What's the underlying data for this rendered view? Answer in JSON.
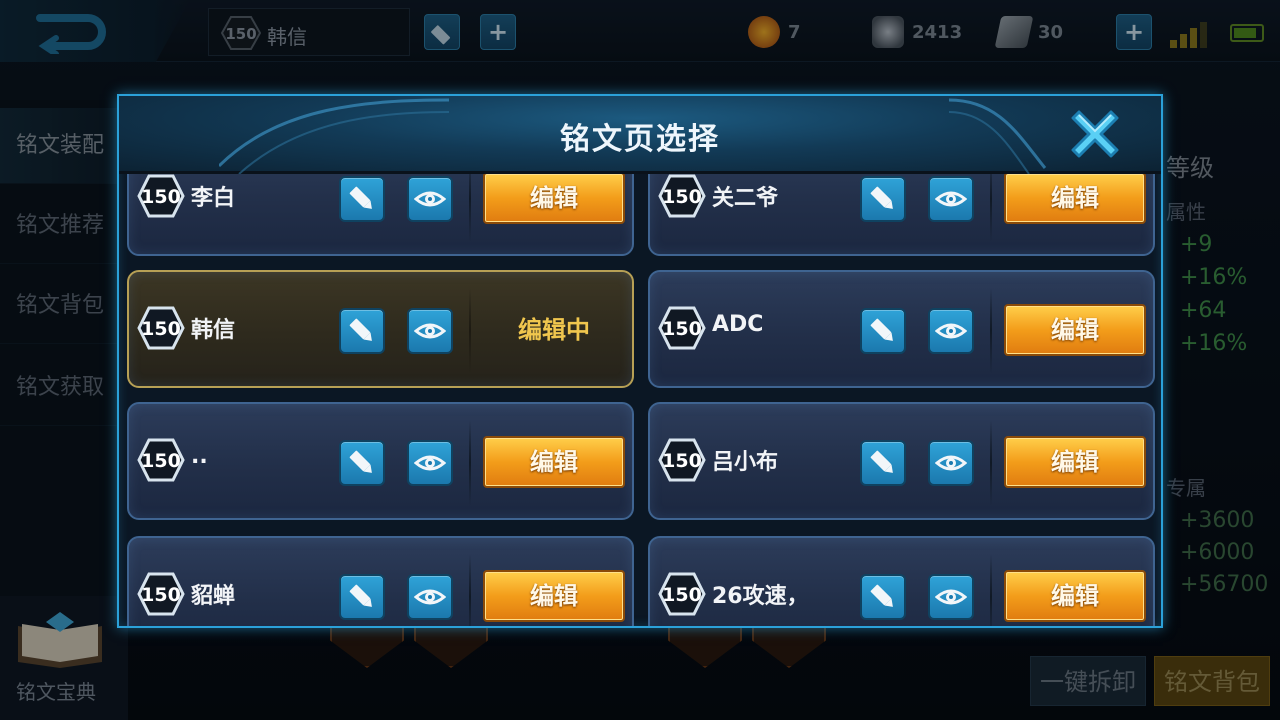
{
  "topbar": {
    "hero_level": "150",
    "hero_name": "韩信",
    "plus_label": "+",
    "resources": [
      {
        "icon": "coin-icon",
        "value": "7"
      },
      {
        "icon": "diamond-icon",
        "value": "2413"
      },
      {
        "icon": "ticket-icon",
        "value": "30"
      }
    ]
  },
  "sidebar": {
    "items": [
      {
        "label": "铭文装配"
      },
      {
        "label": "铭文推荐"
      },
      {
        "label": "铭文背包"
      },
      {
        "label": "铭文获取"
      }
    ],
    "codex_label": "铭文宝典"
  },
  "right_panel": {
    "level_label": "等级",
    "attr_label": "属性",
    "stats": [
      "+9",
      "+16%",
      "+64",
      "+16%"
    ],
    "exclusive_label": "专属",
    "exclusive_stats": [
      "+3600",
      "+6000",
      "+56700"
    ],
    "unload_button": "一键拆卸",
    "bag_button": "铭文背包"
  },
  "modal": {
    "title": "铭文页选择",
    "pages": [
      {
        "level": "150",
        "name": "李白",
        "action": "编辑",
        "current": false
      },
      {
        "level": "150",
        "name": "关二爷",
        "action": "编辑",
        "current": false
      },
      {
        "level": "150",
        "name": "韩信",
        "action": "编辑中",
        "current": true
      },
      {
        "level": "150",
        "name": "ADC",
        "action": "编辑",
        "current": false
      },
      {
        "level": "150",
        "name": "..",
        "action": "编辑",
        "current": false
      },
      {
        "level": "150",
        "name": "吕小布",
        "action": "编辑",
        "current": false
      },
      {
        "level": "150",
        "name": "貂蝉",
        "action": "编辑",
        "current": false
      },
      {
        "level": "150",
        "name": "26攻速，",
        "action": "编辑",
        "current": false
      }
    ]
  },
  "colors": {
    "accent": "#2ba1d9",
    "edit_button": "#f39d1a",
    "current_border": "#b7a055",
    "stat_green": "#3f8f4a"
  }
}
